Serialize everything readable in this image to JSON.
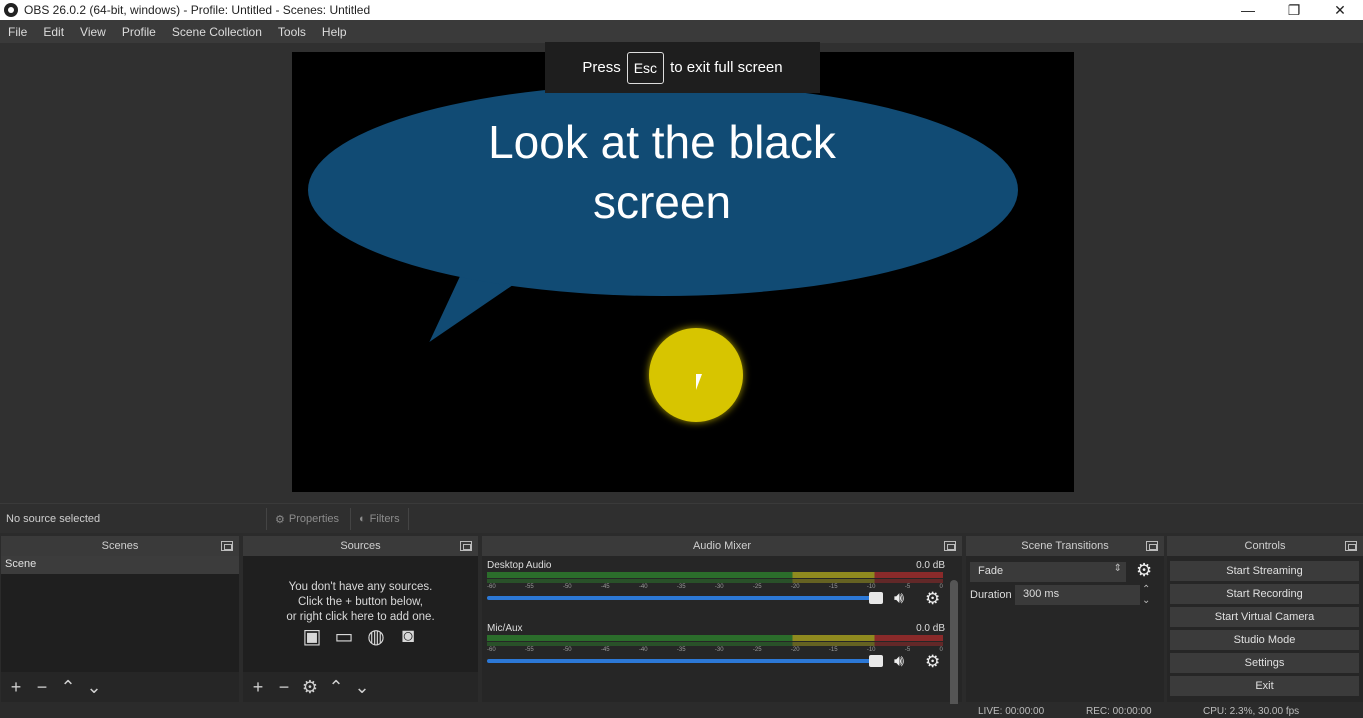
{
  "window": {
    "title": "OBS 26.0.2 (64-bit, windows) - Profile: Untitled - Scenes: Untitled",
    "minimize": "—",
    "restore": "❐",
    "close": "✕"
  },
  "menu": [
    "File",
    "Edit",
    "View",
    "Profile",
    "Scene Collection",
    "Tools",
    "Help"
  ],
  "fullscreen_toast": {
    "prefix": "Press",
    "key": "Esc",
    "suffix": "to exit full screen"
  },
  "preview": {
    "line1": "Look at the black",
    "line2": "screen",
    "bubble_color": "#114b74",
    "dot_color": "#d7c500"
  },
  "source_strip": {
    "no_source": "No source selected",
    "properties": "Properties",
    "filters": "Filters"
  },
  "scenes": {
    "header": "Scenes",
    "items": [
      "Scene"
    ]
  },
  "sources": {
    "header": "Sources",
    "empty_line1": "You don't have any sources.",
    "empty_line2": "Click the + button below,",
    "empty_line3": "or right click here to add one."
  },
  "mixer": {
    "header": "Audio Mixer",
    "ticks": [
      "-60",
      "-55",
      "-50",
      "-45",
      "-40",
      "-35",
      "-30",
      "-25",
      "-20",
      "-15",
      "-10",
      "-5",
      "0"
    ],
    "channels": [
      {
        "name": "Desktop Audio",
        "db": "0.0 dB"
      },
      {
        "name": "Mic/Aux",
        "db": "0.0 dB"
      }
    ]
  },
  "transitions": {
    "header": "Scene Transitions",
    "selected": "Fade",
    "duration_label": "Duration",
    "duration_value": "300 ms"
  },
  "controls": {
    "header": "Controls",
    "buttons": [
      "Start Streaming",
      "Start Recording",
      "Start Virtual Camera",
      "Studio Mode",
      "Settings",
      "Exit"
    ]
  },
  "status": {
    "live": "LIVE: 00:00:00",
    "rec": "REC: 00:00:00",
    "cpu": "CPU: 2.3%, 30.00 fps"
  }
}
